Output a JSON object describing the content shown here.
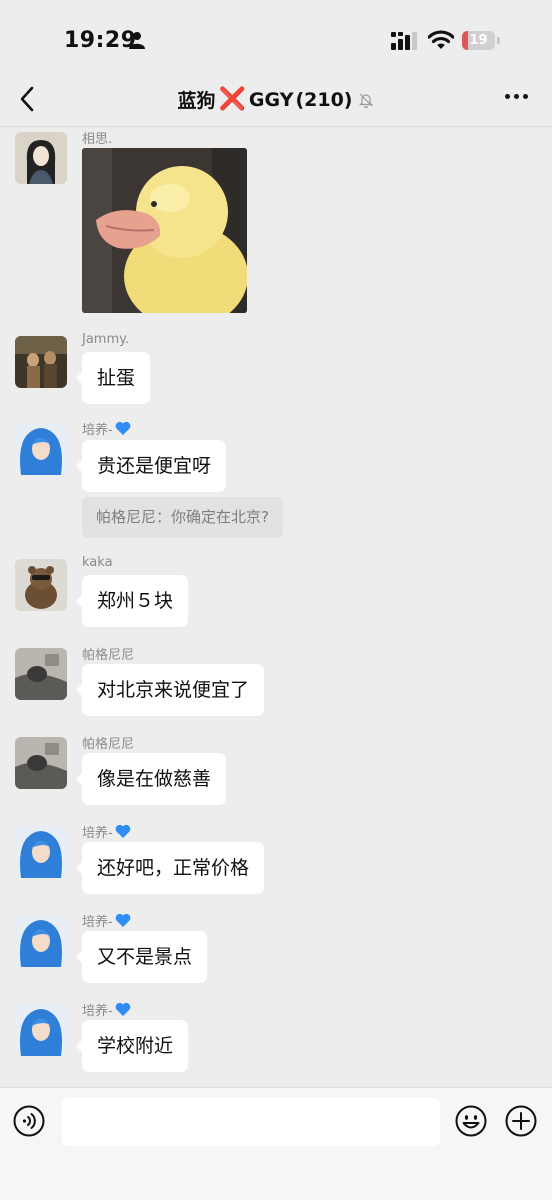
{
  "status_bar": {
    "time": "19:29",
    "battery": "19",
    "battery_level": 0.19
  },
  "header": {
    "title_prefix": "蓝狗",
    "title_mark": "❌",
    "title_suffix": "GGY",
    "member_count": "(210)"
  },
  "messages": [
    {
      "sender": "相思.",
      "type": "sticker"
    },
    {
      "sender": "Jammy.",
      "text": "扯蛋"
    },
    {
      "sender": "培养-",
      "text": "贵还是便宜呀",
      "quote": "帕格尼尼：你确定在北京?"
    },
    {
      "sender": "kaka",
      "text": "郑州５块"
    },
    {
      "sender": "帕格尼尼",
      "text": "对北京来说便宜了"
    },
    {
      "sender": "帕格尼尼",
      "text": "像是在做慈善"
    },
    {
      "sender": "培养-",
      "text": "还好吧，正常价格"
    },
    {
      "sender": "培养-",
      "text": "又不是景点"
    },
    {
      "sender": "培养-",
      "text": "学校附近"
    }
  ],
  "input": {
    "value": "",
    "placeholder": ""
  },
  "icons": {
    "back": "chevron-left-icon",
    "mute": "bell-off-icon",
    "more": "more-dots-icon",
    "voice": "voice-icon",
    "emoji": "emoji-icon",
    "plus": "plus-icon",
    "heart": "blue-heart-icon"
  },
  "colors": {
    "background": "#ededed",
    "bubble": "#ffffff",
    "heart": "#2f8df5",
    "red_x": "#e0242f"
  }
}
